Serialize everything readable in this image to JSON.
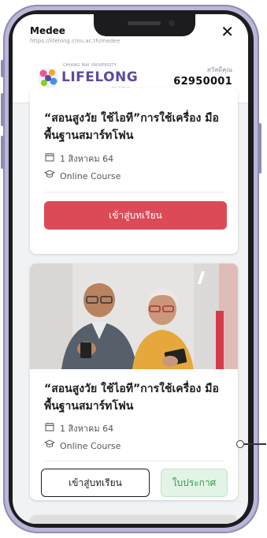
{
  "topbar": {
    "title": "Medee",
    "url": "https://lifelong.cmu.ac.th/medee",
    "close": "✕"
  },
  "header": {
    "logo_small": "CHIANG MAI UNIVERSITY",
    "logo_text": "LIFELONG",
    "logo_edu": "EDUCATION",
    "greeting": "สวัสดีคุณ",
    "user_id": "62950001"
  },
  "cards": [
    {
      "title": "“สอนสูงวัย ใช้ไอที”การใช้เครื่อง มือพื้นฐานสมาร์ทโฟน",
      "date": "1 สิงหาคม 64",
      "type": "Online Course",
      "primary_button": "เข้าสู่บทเรียน"
    },
    {
      "title": "“สอนสูงวัย ใช้ไอที”การใช้เครื่อง มือพื้นฐานสมาร์ทโฟน",
      "date": "1 สิงหาคม 64",
      "type": "Online Course",
      "primary_button": "เข้าสู่บทเรียน",
      "secondary_button": "ใบประกาศ"
    }
  ],
  "colors": {
    "accent_red": "#dc4a58",
    "success_green": "#2f9e4e",
    "brand_purple": "#5b4a9e"
  },
  "icons": {
    "calendar": "calendar-icon",
    "course": "graduation-cap-icon",
    "close": "close-icon"
  }
}
